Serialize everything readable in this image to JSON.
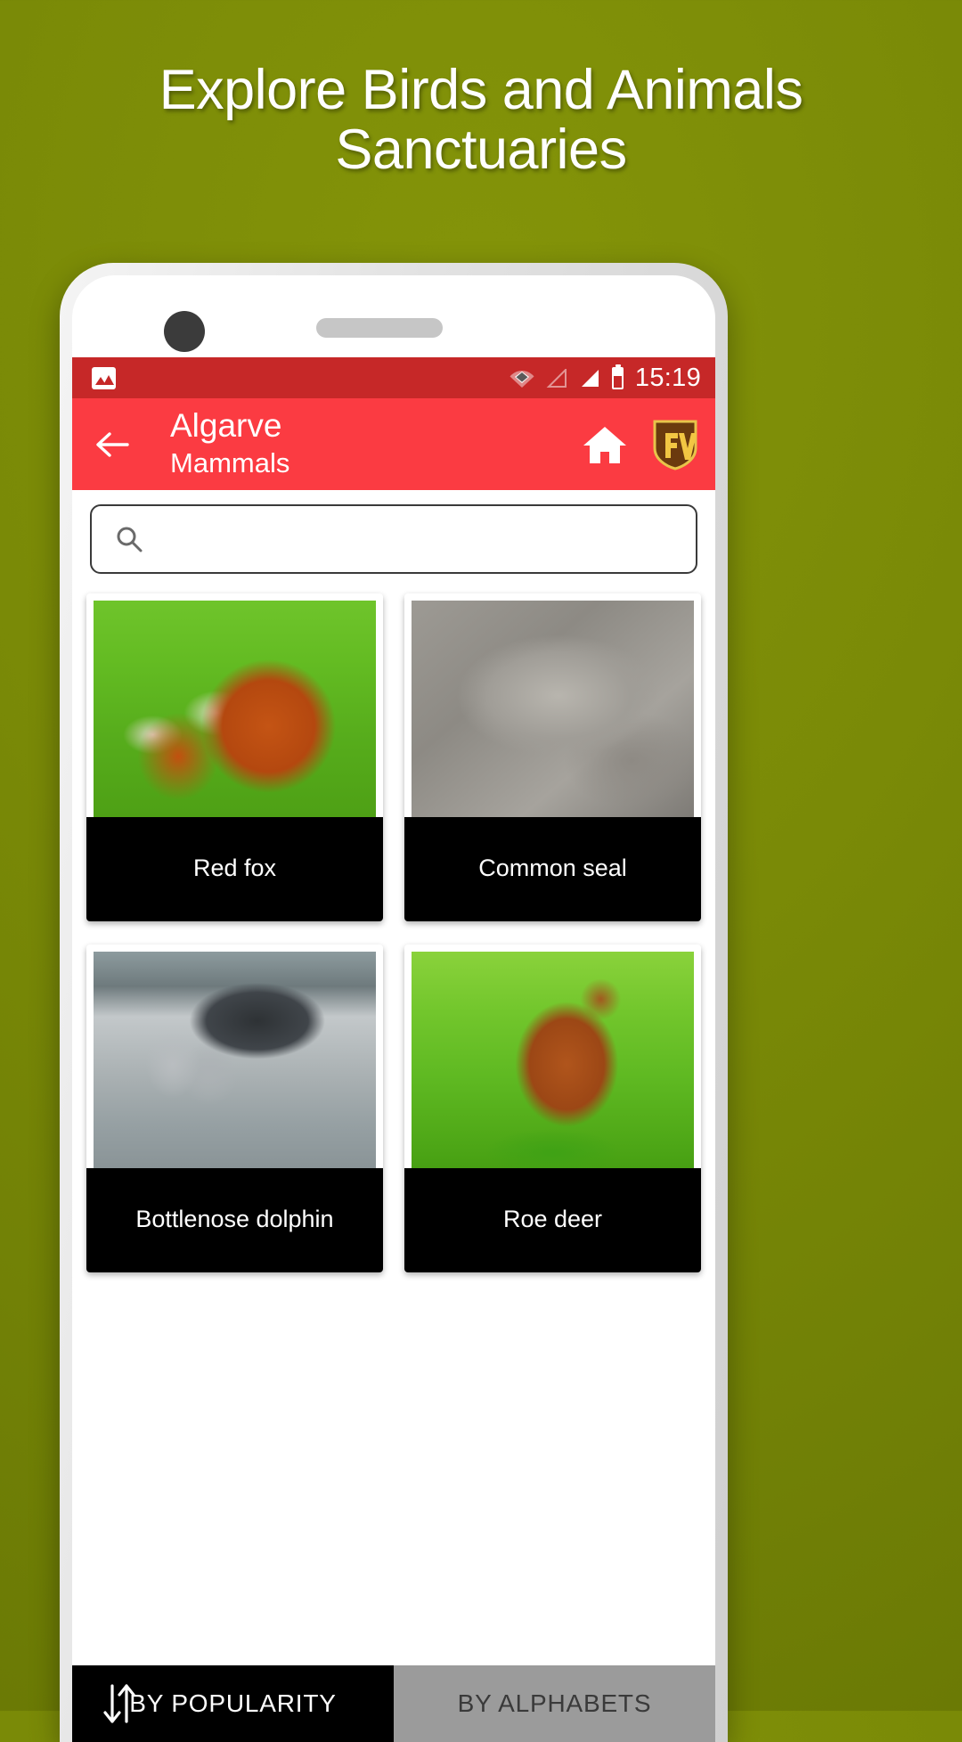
{
  "promo": {
    "headline_line1": "Explore Birds and Animals",
    "headline_line2": "Sanctuaries",
    "background_color": "#7a8a07",
    "text_color": "#ffffff"
  },
  "statusbar": {
    "background_color": "#c62828",
    "notification_icon": "photo-icon",
    "wifi_icon": "wifi-icon",
    "signal_icon": "signal-triangle-icon",
    "cellular_icon": "cellular-bars-icon",
    "battery_icon": "battery-icon",
    "clock": "15:19"
  },
  "appbar": {
    "background_color": "#fb3b42",
    "back_icon": "back-arrow-icon",
    "title": "Algarve",
    "subtitle": "Mammals",
    "home_icon": "home-icon",
    "logo_badge": "fv-shield-logo",
    "logo_text": "FV"
  },
  "search": {
    "icon": "search-icon",
    "value": "",
    "placeholder": ""
  },
  "grid": {
    "cards": [
      {
        "label": "Red fox",
        "image": "red-fox-photo"
      },
      {
        "label": "Common seal",
        "image": "common-seal-photo"
      },
      {
        "label": "Bottlenose dolphin",
        "image": "bottlenose-dolphin-photo"
      },
      {
        "label": "Roe deer",
        "image": "roe-deer-photo"
      }
    ]
  },
  "sortbar": {
    "sort_icon": "sort-arrows-icon",
    "tabs": [
      {
        "label": "BY POPULARITY",
        "active": true,
        "background_color": "#000000",
        "text_color": "#ffffff"
      },
      {
        "label": "BY ALPHABETS",
        "active": false,
        "background_color": "#9b9b9b",
        "text_color": "#3a3a3a"
      }
    ]
  }
}
